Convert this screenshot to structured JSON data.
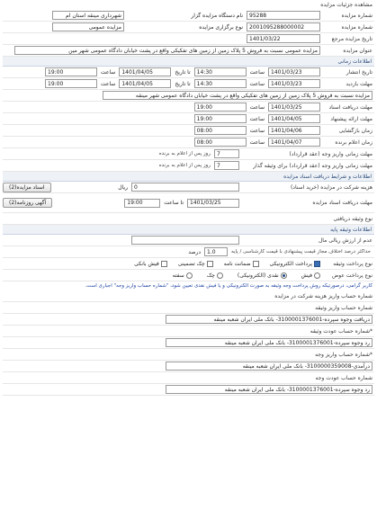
{
  "page_title": "مشاهده جزئیات مزایده",
  "header": {
    "auction_number_label": "شماره مزایده",
    "auction_number": "95288",
    "gateway_label": "نام دستگاه مزایده گزار",
    "gateway": "شهرداری مینقه استان ام",
    "need_number_label": "شماره مزایده",
    "need_number": "2001095288000002",
    "type_label": "نوع برگزاری مزایده",
    "type": "مزایده عمومی",
    "ref_date_label": "تاریخ مزایده مرجع",
    "ref_date": "1401/03/22",
    "subject_label": "عنوان مزایده",
    "subject": "مزایده عمومی نسبت به فروش 5 پلاک زمین از زمین های تفکیکی واقع در پشت خیابان دادگاه عمومی شهر مین"
  },
  "timing": {
    "section": "اطلاعات زمانی",
    "publish_label": "تاریخ انتشار",
    "publish_date": "1401/03/23",
    "time_label": "ساعت",
    "publish_time": "14:30",
    "until_label": "تا تاریخ",
    "publish_until_date": "1401/04/05",
    "publish_until_time": "19:00",
    "visit_label": "مهلت بازدید",
    "visit_date": "1401/03/23",
    "visit_time": "14:30",
    "visit_until_date": "1401/04/05",
    "visit_until_time": "19:00",
    "address_label": "مزایده نسبت به فروش 5 پلاک زمین از زمین های تفکیکی واقع در پشت خیابان دادگاه عمومی شهر مینقه",
    "doc_receive_label": "مهلت دریافت اسناد",
    "doc_receive_date": "1401/03/25",
    "doc_receive_time": "19:00",
    "submit_label": "مهلت ارائه پیشنهاد",
    "submit_date": "1401/04/05",
    "submit_time": "19:00",
    "open_label": "زمان بازگشایی",
    "open_date": "1401/04/06",
    "open_time": "08:00",
    "announce_label": "زمان اعلام برنده",
    "announce_date": "1401/04/07",
    "announce_time": "08:00"
  },
  "contract": {
    "deadline_label": "مهلت زمانی واریز وجه (عقد قرارداد)",
    "deadline_value": "7",
    "deadline_unit": "روز پس از اعلام به برنده",
    "guarantee_label": "مهلت زمانی واریز وجه (عقد قرارداد) برای وثیقه گذار",
    "guarantee_value": "7",
    "guarantee_unit": "روز پس از اعلام به برنده"
  },
  "docs": {
    "section": "اطلاعات و شرایط دریافت اسناد مزایده",
    "price_label": "هزینه شرکت در مزایده (خرید اسناد)",
    "price_value": "0",
    "currency": "ریال",
    "doc_button": "اسناد مزایده(2)",
    "doc_deadline_label": "مهلت دریافت اسناد مزایده",
    "doc_deadline_date": "1401/03/25",
    "doc_deadline_time_label": "تا ساعت",
    "doc_deadline_time": "19:00",
    "ads_button": "آگهی روزنامه(2)",
    "guarantee_type_label": "نوع وثیقه دریافتی"
  },
  "guarantee": {
    "section": "اطلاعات وثیقه پایه",
    "min_label": "حداکثر درصد اختلاف مجاز قیمت پیشنهادی با قیمت کارشناسی / پایه",
    "min_percent": "1.0",
    "percent_label": "درصد",
    "base_label": "عدم از ارزش ریالی مال",
    "methods_label": "نوع پرداخت وثیقه",
    "methods": [
      "پرداخت الکترونیکی",
      "ضمانت نامه",
      "چک تضمینی",
      "فیش بانکی"
    ],
    "pay_label": "نوع پرداخت عوض",
    "pays": [
      "فیش",
      "نقدی (الکترونیکی)",
      "چک",
      "سفته"
    ]
  },
  "notes": {
    "note": "کاربر گرامی، درصورتیکه روش پرداخت وجه وثیقه به صورت الکترونیکی و یا فیش نقدی تعیین شود، \"شماره حساب واریز وجه\" اجباری است.",
    "account_section": "شماره حساب واریز هزینه شرکت در مزایده",
    "account_label": "شماره حساب واریز وثیقه",
    "account_value": "دریافت وجوه سپرده-3100001376001- بانک ملی ایران شعبه مینقه",
    "return_label": "*شماره حساب عودت وثیقه",
    "return_value": "رد وجوه سپرده-3100001376001- بانک ملی ایران شعبه مینقه",
    "pay_account_label": "*شماره حساب واریز وجه",
    "pay_account_value": "درآمدی-3100000359008- بانک ملی ایران شعبه مینقه",
    "refund_label": "شماره حساب عودت وجه",
    "refund_value": "رد وجوه سپرده-3100001376001- بانک ملی ایران شعبه مینقه"
  }
}
